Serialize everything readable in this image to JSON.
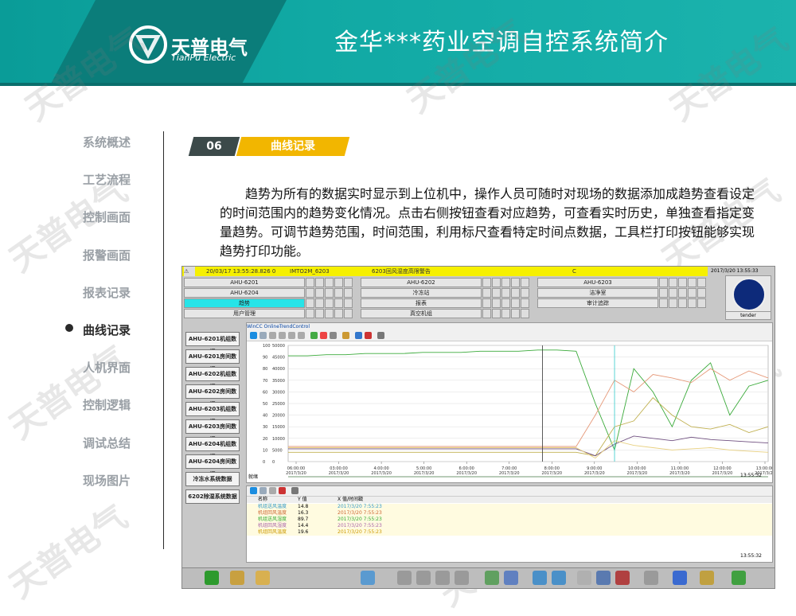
{
  "header": {
    "logo_text": "天普电气",
    "logo_sub": "TianPu Electric",
    "title": "金华***药业空调自控系统简介"
  },
  "sidebar": {
    "items": [
      {
        "label": "系统概述",
        "active": false
      },
      {
        "label": "工艺流程",
        "active": false
      },
      {
        "label": "控制画面",
        "active": false
      },
      {
        "label": "报警画面",
        "active": false
      },
      {
        "label": "报表记录",
        "active": false
      },
      {
        "label": "曲线记录",
        "active": true
      },
      {
        "label": "人机界面",
        "active": false
      },
      {
        "label": "控制逻辑",
        "active": false
      },
      {
        "label": "调试总结",
        "active": false
      },
      {
        "label": "现场图片",
        "active": false
      }
    ]
  },
  "section": {
    "number": "06",
    "name": "曲线记录",
    "description": "趋势为所有的数据实时显示到上位机中，操作人员可随时对现场的数据添加成趋势查看设定的时间范围内的趋势变化情况。点击右侧按钮查看对应趋势，可查看实时历史，单独查看指定变量趋势。可调节趋势范围，时间范围，利用标尺查看特定时间点数据，工具栏打印按钮能够实现趋势打印功能。"
  },
  "screenshot": {
    "status": {
      "datetime": "20/03/17 13:55:28.826 0",
      "tag": "IMTO2M_6203",
      "alarm": "6203回风湿度高限警告",
      "unit": "C"
    },
    "clock": "2017/3/20 13:55:33",
    "logo_button": "tender",
    "top_buttons": [
      "AHU-6201",
      "AHU-6202",
      "AHU-6203",
      "AHU-6204",
      "冷冻站",
      "洁净室",
      "趋势",
      "报表",
      "审计追踪",
      "用户管理",
      "真空机组"
    ],
    "side_buttons": [
      "AHU-6201机组数据",
      "AHU-6201房间数据",
      "AHU-6202机组数据",
      "AHU-6202房间数据",
      "AHU-6203机组数据",
      "AHU-6203房间数据",
      "AHU-6204机组数据",
      "AHU-6204房间数据",
      "冷冻水系统数据",
      "6202除湿系统数据"
    ],
    "trend_title": "WinCC OnlineTrendControl",
    "trend_status": "就绪",
    "trend_clock": "13:55:32",
    "table": {
      "headers": [
        "名称",
        "Y 值",
        "X 值/时间戳"
      ],
      "rows": [
        {
          "name": "机组送风温度",
          "y": "14.8",
          "x": "2017/3/20 7:55:23"
        },
        {
          "name": "机组回风温度",
          "y": "16.3",
          "x": "2017/3/20 7:55:23"
        },
        {
          "name": "机组送风湿度",
          "y": "89.7",
          "x": "2017/3/20 7:55:23"
        },
        {
          "name": "机组回风湿度",
          "y": "14.4",
          "x": "2017/3/20 7:55:23"
        },
        {
          "name": "机组回风温度",
          "y": "19.6",
          "x": "2017/3/20 7:55:23"
        }
      ],
      "table_clock": "13:55:32"
    }
  },
  "chart_data": {
    "type": "line",
    "y_ticks_left": [
      "100",
      "90",
      "80",
      "70",
      "60",
      "50",
      "40",
      "30",
      "20",
      "10",
      "0"
    ],
    "y_ticks_right": [
      "50000",
      "45000",
      "40000",
      "35000",
      "30000",
      "25000",
      "20000",
      "15000",
      "10000",
      "5000",
      "0"
    ],
    "x_ticks": [
      {
        "time": "06:00:00",
        "date": "2017/3/20"
      },
      {
        "time": "03:00:00",
        "date": "2017/3/20"
      },
      {
        "time": "4:00:00",
        "date": "2017/3/20"
      },
      {
        "time": "5:00:00",
        "date": "2017/3/20"
      },
      {
        "time": "6:00:00",
        "date": "2017/3/20"
      },
      {
        "time": "7:00:00",
        "date": "2017/3/20"
      },
      {
        "time": "8:00:00",
        "date": "2017/3/20"
      },
      {
        "time": "9:00:00",
        "date": "2017/3/20"
      },
      {
        "time": "10:00:00",
        "date": "2017/3/20"
      },
      {
        "time": "11:00:00",
        "date": "2017/3/20"
      },
      {
        "time": "12:00:00",
        "date": "2017/3/20"
      },
      {
        "time": "13:00:00",
        "date": "2017/3/20"
      }
    ],
    "ylim": [
      0,
      100
    ],
    "series": [
      {
        "color": "#3aaa3a",
        "values": [
          91,
          91,
          92,
          92,
          93,
          93,
          93,
          94,
          94,
          94,
          95,
          95,
          95,
          96,
          96,
          95,
          50,
          10,
          80,
          60,
          30,
          70,
          85,
          40,
          65,
          70
        ]
      },
      {
        "color": "#e69a7a",
        "values": [
          13,
          13,
          13,
          13,
          13,
          13,
          13,
          13,
          13,
          13,
          13,
          13,
          13,
          13,
          13,
          13,
          40,
          70,
          60,
          75,
          72,
          68,
          80,
          70,
          78,
          72
        ]
      },
      {
        "color": "#c0b050",
        "values": [
          8,
          8,
          8,
          8,
          8,
          8,
          8,
          8,
          8,
          8,
          8,
          8,
          8,
          8,
          8,
          8,
          5,
          30,
          35,
          55,
          40,
          30,
          28,
          32,
          25,
          30
        ]
      },
      {
        "color": "#705080",
        "values": [
          11,
          11,
          11,
          11,
          11,
          11,
          11,
          11,
          11,
          11,
          11,
          11,
          11,
          11,
          11,
          11,
          5,
          15,
          22,
          20,
          18,
          21,
          19,
          18,
          17,
          16
        ]
      },
      {
        "color": "#e8d080",
        "values": [
          12,
          12,
          12,
          12,
          12,
          12,
          12,
          12,
          12,
          12,
          12,
          12,
          12,
          12,
          12,
          12,
          3,
          18,
          14,
          12,
          10,
          11,
          12,
          10,
          9,
          8
        ]
      }
    ],
    "ruler_positions": [
      0.53,
      0.68
    ],
    "grid": true
  }
}
